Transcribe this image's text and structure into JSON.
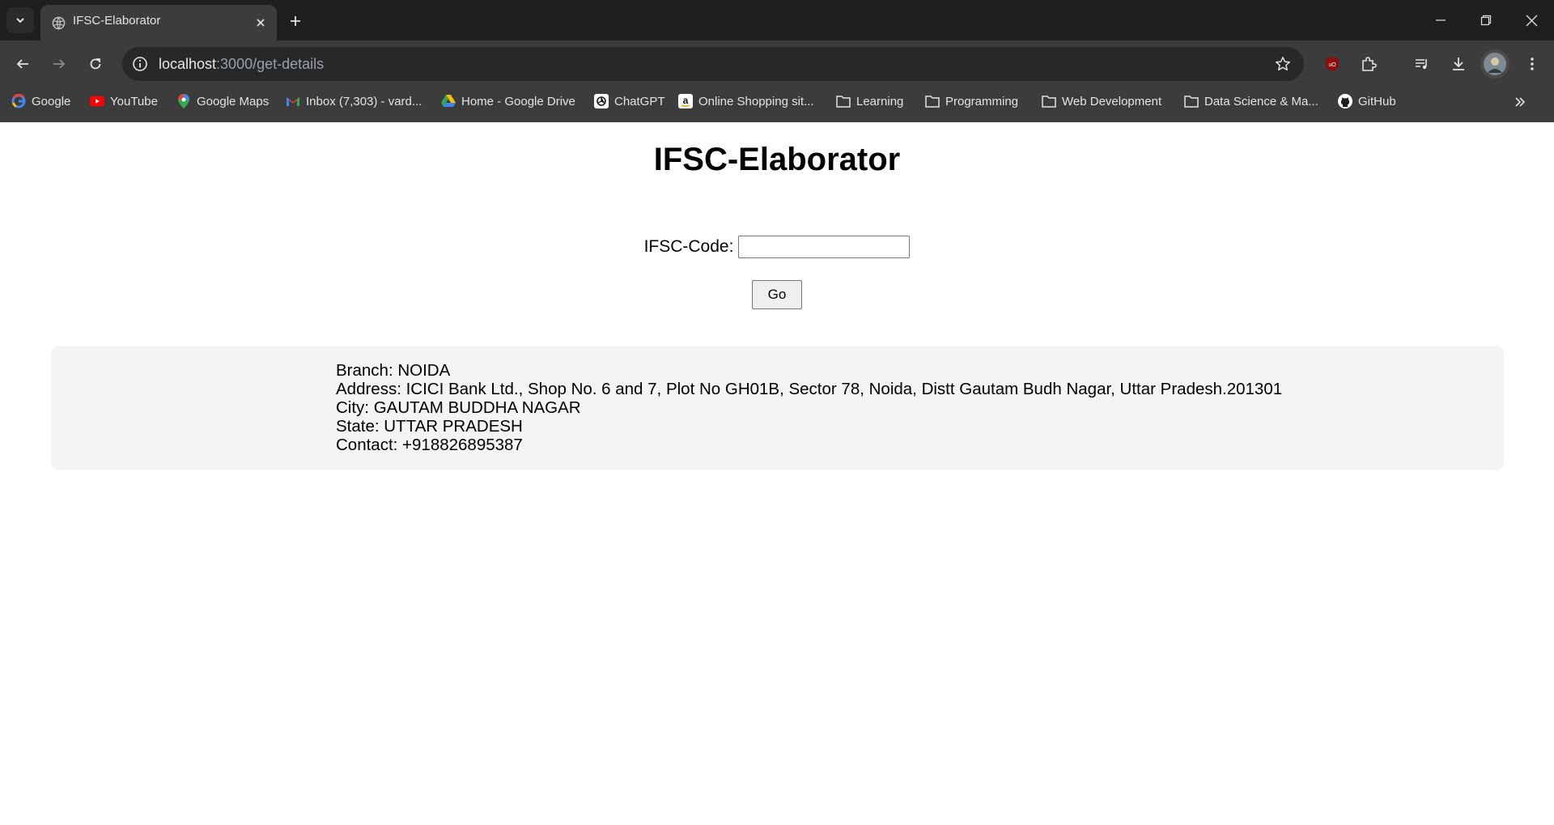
{
  "browser": {
    "tab": {
      "title": "IFSC-Elaborator"
    },
    "address_bar": {
      "host": "localhost",
      "path": ":3000/get-details"
    },
    "bookmarks": [
      {
        "label": "Google",
        "icon": "google-icon"
      },
      {
        "label": "YouTube",
        "icon": "youtube-icon"
      },
      {
        "label": "Google Maps",
        "icon": "maps-icon"
      },
      {
        "label": "Inbox (7,303) - vard...",
        "icon": "gmail-icon"
      },
      {
        "label": "Home - Google Drive",
        "icon": "drive-icon"
      },
      {
        "label": "ChatGPT",
        "icon": "chatgpt-icon"
      },
      {
        "label": "Online Shopping sit...",
        "icon": "amazon-icon"
      },
      {
        "label": "Learning",
        "icon": "folder-icon"
      },
      {
        "label": "Programming",
        "icon": "folder-icon"
      },
      {
        "label": "Web Development",
        "icon": "folder-icon"
      },
      {
        "label": "Data Science & Ma...",
        "icon": "folder-icon"
      },
      {
        "label": "GitHub",
        "icon": "github-icon"
      }
    ]
  },
  "page": {
    "title": "IFSC-Elaborator",
    "form": {
      "label": "IFSC-Code:",
      "input_value": "",
      "submit_label": "Go"
    },
    "details": {
      "branch": "Branch: NOIDA",
      "address": "Address: ICICI Bank Ltd., Shop No. 6 and 7, Plot No GH01B, Sector 78, Noida, Distt Gautam Budh Nagar, Uttar Pradesh.201301",
      "city": "City: GAUTAM BUDDHA NAGAR",
      "state": "State: UTTAR PRADESH",
      "contact": "Contact: +918826895387"
    }
  },
  "colors": {
    "chrome_dark": "#1f1f1f",
    "chrome_toolbar": "#3c3c3c",
    "omnibox": "#282828",
    "details_bg": "#f4f4f4"
  }
}
